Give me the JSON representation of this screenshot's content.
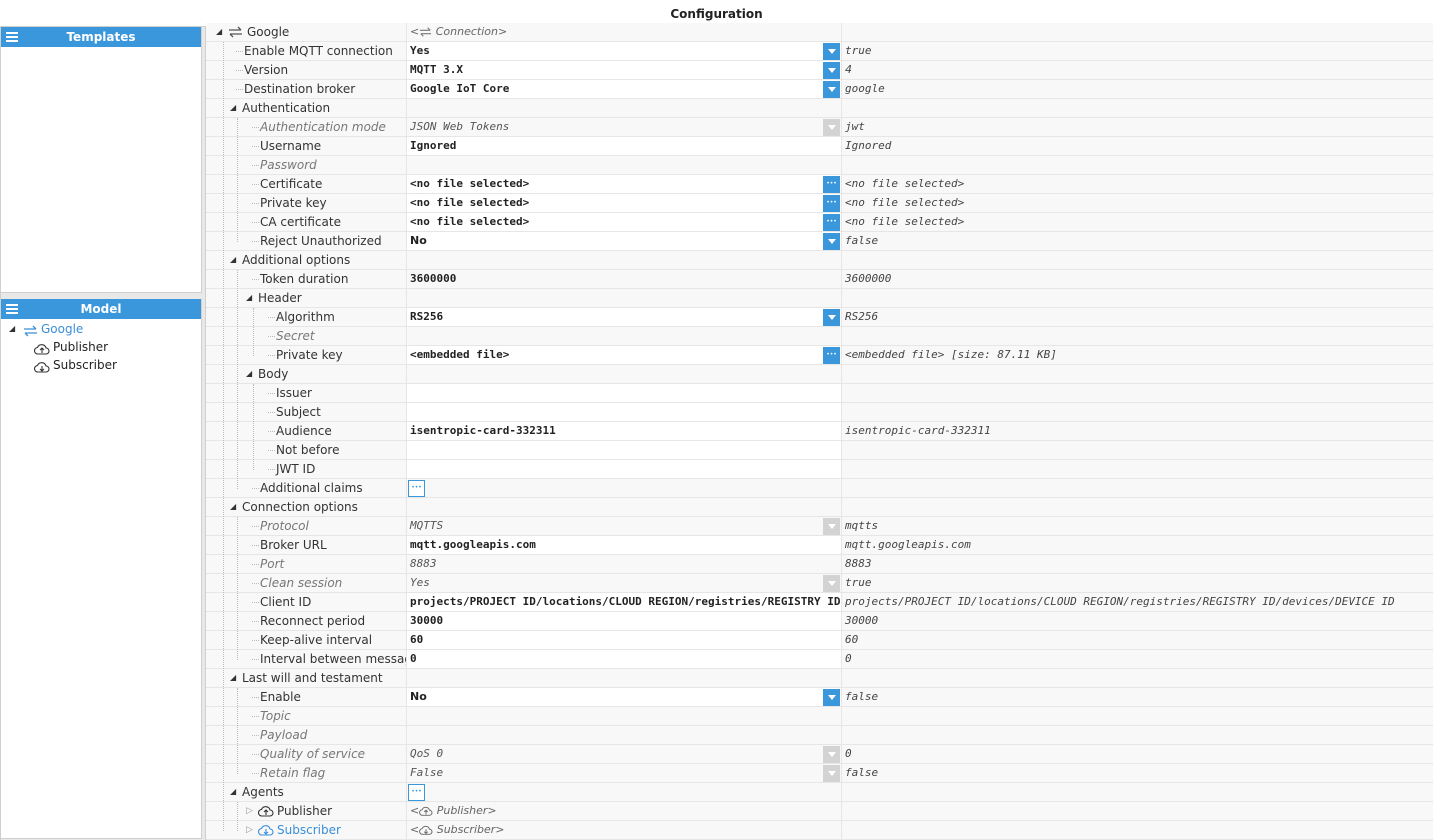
{
  "window_title": "Configuration",
  "panels": {
    "templates": {
      "title": "Templates"
    },
    "model": {
      "title": "Model",
      "tree": [
        {
          "label": "Google",
          "icon": "connection-icon",
          "selected": true
        },
        {
          "label": "Publisher",
          "icon": "cloud-upload-icon"
        },
        {
          "label": "Subscriber",
          "icon": "cloud-download-icon"
        }
      ]
    }
  },
  "grid": {
    "rows": [
      {
        "id": "google",
        "label": "Google",
        "value": "< Connection>",
        "raw": ""
      },
      {
        "id": "enable-mqtt",
        "label": "Enable MQTT connection",
        "value": "Yes",
        "raw": "true"
      },
      {
        "id": "version",
        "label": "Version",
        "value": "MQTT 3.X",
        "raw": "4"
      },
      {
        "id": "destination-broker",
        "label": "Destination broker",
        "value": "Google IoT Core",
        "raw": "google"
      },
      {
        "id": "authentication",
        "label": "Authentication",
        "value": "",
        "raw": ""
      },
      {
        "id": "auth-mode",
        "label": "Authentication mode",
        "value": "JSON Web Tokens",
        "raw": "jwt"
      },
      {
        "id": "username",
        "label": "Username",
        "value": "Ignored",
        "raw": "Ignored"
      },
      {
        "id": "password",
        "label": "Password",
        "value": "",
        "raw": ""
      },
      {
        "id": "certificate",
        "label": "Certificate",
        "value": "<no file selected>",
        "raw": "<no file selected>"
      },
      {
        "id": "private-key",
        "label": "Private key",
        "value": "<no file selected>",
        "raw": "<no file selected>"
      },
      {
        "id": "ca-certificate",
        "label": "CA certificate",
        "value": "<no file selected>",
        "raw": "<no file selected>"
      },
      {
        "id": "reject-unauthorized",
        "label": "Reject Unauthorized",
        "value": "No",
        "raw": "false"
      },
      {
        "id": "additional-options",
        "label": "Additional options",
        "value": "",
        "raw": ""
      },
      {
        "id": "token-duration",
        "label": "Token duration",
        "value": "3600000",
        "raw": "3600000"
      },
      {
        "id": "header",
        "label": "Header",
        "value": "",
        "raw": ""
      },
      {
        "id": "algorithm",
        "label": "Algorithm",
        "value": "RS256",
        "raw": "RS256"
      },
      {
        "id": "secret",
        "label": "Secret",
        "value": "",
        "raw": ""
      },
      {
        "id": "header-private-key",
        "label": "Private key",
        "value": "<embedded file>",
        "raw": "<embedded file> [size: 87.11 KB]"
      },
      {
        "id": "body",
        "label": "Body",
        "value": "",
        "raw": ""
      },
      {
        "id": "issuer",
        "label": "Issuer",
        "value": "",
        "raw": ""
      },
      {
        "id": "subject",
        "label": "Subject",
        "value": "",
        "raw": ""
      },
      {
        "id": "audience",
        "label": "Audience",
        "value": "isentropic-card-332311",
        "raw": "isentropic-card-332311"
      },
      {
        "id": "not-before",
        "label": "Not before",
        "value": "",
        "raw": ""
      },
      {
        "id": "jwt-id",
        "label": "JWT ID",
        "value": "",
        "raw": ""
      },
      {
        "id": "additional-claims",
        "label": "Additional claims",
        "value": "",
        "raw": ""
      },
      {
        "id": "connection-options",
        "label": "Connection options",
        "value": "",
        "raw": ""
      },
      {
        "id": "protocol",
        "label": "Protocol",
        "value": "MQTTS",
        "raw": "mqtts"
      },
      {
        "id": "broker-url",
        "label": "Broker URL",
        "value": "mqtt.googleapis.com",
        "raw": "mqtt.googleapis.com"
      },
      {
        "id": "port",
        "label": "Port",
        "value": "8883",
        "raw": "8883"
      },
      {
        "id": "clean-session",
        "label": "Clean session",
        "value": "Yes",
        "raw": "true"
      },
      {
        "id": "client-id",
        "label": "Client ID",
        "value": "projects/PROJECT ID/locations/CLOUD REGION/registries/REGISTRY ID/devices/DEVICE ID",
        "raw": "projects/PROJECT ID/locations/CLOUD REGION/registries/REGISTRY ID/devices/DEVICE ID"
      },
      {
        "id": "reconnect-period",
        "label": "Reconnect period",
        "value": "30000",
        "raw": "30000"
      },
      {
        "id": "keep-alive",
        "label": "Keep-alive interval",
        "value": "60",
        "raw": "60"
      },
      {
        "id": "interval-messages",
        "label": "Interval between messages",
        "value": "0",
        "raw": "0"
      },
      {
        "id": "last-will",
        "label": "Last will and testament",
        "value": "",
        "raw": ""
      },
      {
        "id": "lwt-enable",
        "label": "Enable",
        "value": "No",
        "raw": "false"
      },
      {
        "id": "topic",
        "label": "Topic",
        "value": "",
        "raw": ""
      },
      {
        "id": "payload",
        "label": "Payload",
        "value": "",
        "raw": ""
      },
      {
        "id": "qos",
        "label": "Quality of service",
        "value": "QoS 0",
        "raw": "0"
      },
      {
        "id": "retain-flag",
        "label": "Retain flag",
        "value": "False",
        "raw": "false"
      },
      {
        "id": "agents",
        "label": "Agents",
        "value": "",
        "raw": ""
      },
      {
        "id": "agent-publisher",
        "label": "Publisher",
        "value": "< Publisher>",
        "raw": ""
      },
      {
        "id": "agent-subscriber",
        "label": "Subscriber",
        "value": "< Subscriber>",
        "raw": ""
      }
    ]
  },
  "colors": {
    "accent": "#3a97dc",
    "link": "#3a8fd8",
    "disabled": "#d3d3d3"
  }
}
